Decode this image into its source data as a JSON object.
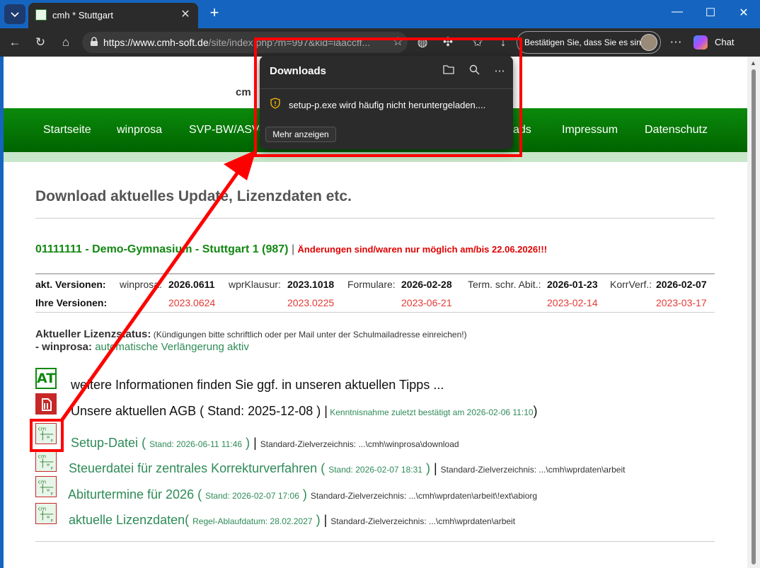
{
  "browser": {
    "tab_title": "cmh * Stuttgart",
    "url_host": "https://www.cmh-soft.de",
    "url_rest": "/site/index.php?m=997&kid=iaaccff...",
    "confirm_pill": "Bestätigen Sie, dass Sie es sind",
    "chat_label": "Chat"
  },
  "downloads": {
    "title": "Downloads",
    "file_warning": "setup-p.exe wird häufig nicht heruntergeladen....",
    "show_more": "Mehr anzeigen"
  },
  "site": {
    "logo_text": "cm",
    "nav": [
      "Startseite",
      "winprosa",
      "SVP-BW/ASV-B",
      "ads",
      "Impressum",
      "Datenschutz"
    ]
  },
  "main": {
    "heading": "Download aktuelles Update, Lizenzdaten etc.",
    "school": "01111111 - Demo-Gymnasium - Stuttgart 1 (987)",
    "school_sep": " | ",
    "school_warning": "Änderungen sind/waren nur möglich am/bis 22.06.2026!!!",
    "versions": {
      "row1_label": "akt. Versionen:",
      "row2_label": "Ihre Versionen:",
      "items": [
        {
          "name": "winprosa:",
          "current": "2026.0611",
          "yours": "2023.0624"
        },
        {
          "name": "wprKlausur:",
          "current": "2023.1018",
          "yours": "2023.0225"
        },
        {
          "name": "Formulare:",
          "current": "2026-02-28",
          "yours": "2023-06-21"
        },
        {
          "name": "Term. schr. Abit.:",
          "current": "2026-01-23",
          "yours": "2023-02-14"
        },
        {
          "name": "KorrVerf.:",
          "current": "2026-02-07",
          "yours": "2023-03-17"
        }
      ]
    },
    "license": {
      "title": "Aktueller Lizenzstatus:",
      "note": " (Kündigungen bitte schriftlich oder per Mail unter der Schulmailadresse einreichen!)",
      "product": "- winprosa:",
      "status": "automatische Verlängerung aktiv"
    },
    "tips": {
      "icon_text": "AT",
      "text": "weitere Informationen finden Sie ggf. in unseren aktuellen Tipps ..."
    },
    "agb": {
      "text": "Unsere aktuellen AGB ( Stand: 2025-12-08 ) ",
      "sep": "|",
      "ack": " Kenntnisnahme zuletzt bestätigt am 2026-02-06 11:10",
      "close": ")"
    },
    "downloads_list": [
      {
        "label": "Setup-Datei",
        "stand_open": " ( ",
        "stand": "Stand: 2026-06-11 11:46",
        "stand_close": " )",
        "sep": " | ",
        "target": "Standard-Zielverzeichnis: ...\\cmh\\winprosa\\download"
      },
      {
        "label": "Steuerdatei für zentrales Korrekturverfahren",
        "stand_open": " ( ",
        "stand": "Stand: 2026-02-07 18:31",
        "stand_close": " )",
        "sep": " | ",
        "target": "Standard-Zielverzeichnis: ...\\cmh\\wprdaten\\arbeit"
      },
      {
        "label": "Abiturtermine für 2026",
        "stand_open": " ( ",
        "stand": "Stand: 2026-02-07 17:06",
        "stand_close": " )",
        "sep": " ",
        "target": "Standard-Zielverzeichnis: ...\\cmh\\wprdaten\\arbeit\\!ext\\abiorg"
      },
      {
        "label": "aktuelle Lizenzdaten",
        "stand_open": "( ",
        "stand": "Regel-Ablaufdatum: 28.02.2027",
        "stand_close": " )",
        "sep": " | ",
        "target": "Standard-Zielverzeichnis: ...\\cmh\\wprdaten\\arbeit"
      }
    ]
  },
  "colors": {
    "nav_green": "#0b8a0b",
    "link_green": "#2e8b57",
    "alert_red": "#e00000",
    "annotation_red": "#ff0000"
  }
}
